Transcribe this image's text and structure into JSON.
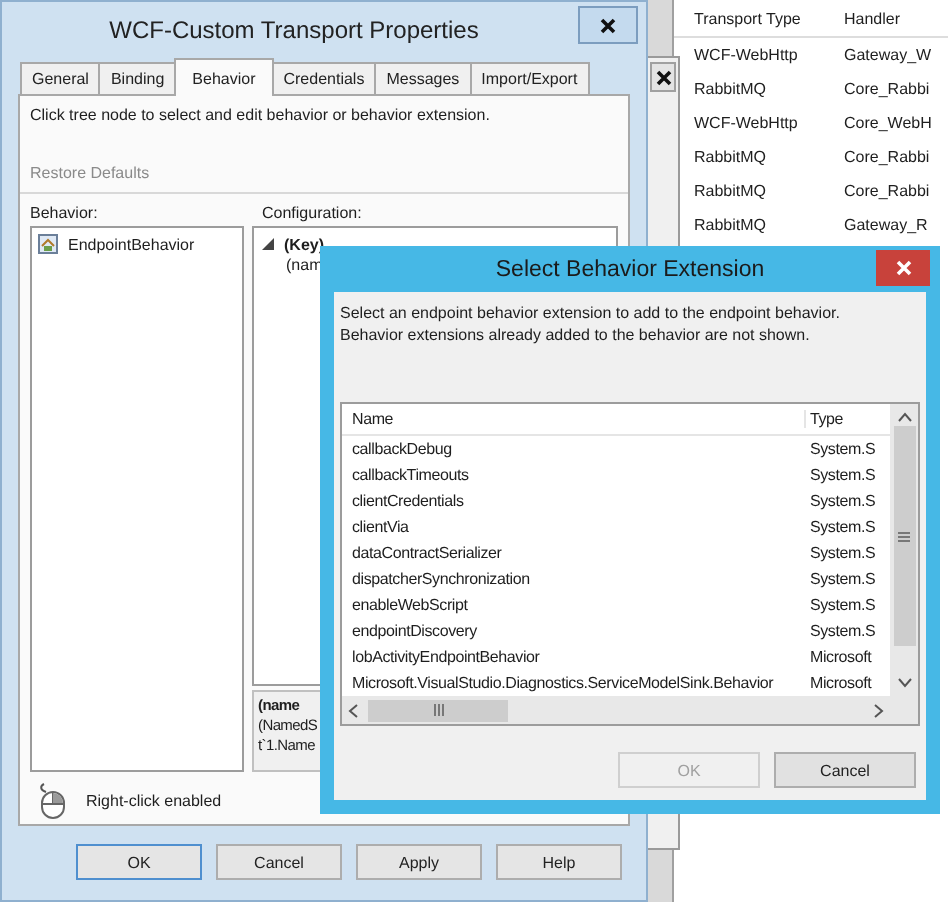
{
  "background_window": {
    "columns": [
      "Transport Type",
      "Handler"
    ],
    "rows": [
      [
        "WCF-WebHttp",
        "Gateway_W"
      ],
      [
        "RabbitMQ",
        "Core_Rabbi"
      ],
      [
        "WCF-WebHttp",
        "Core_WebH"
      ],
      [
        "RabbitMQ",
        "Core_Rabbi"
      ],
      [
        "RabbitMQ",
        "Core_Rabbi"
      ],
      [
        "RabbitMQ",
        "Gateway_R"
      ]
    ]
  },
  "properties_window": {
    "title": "WCF-Custom Transport Properties",
    "tabs": [
      {
        "label": "General",
        "selected": false
      },
      {
        "label": "Binding",
        "selected": false
      },
      {
        "label": "Behavior",
        "selected": true
      },
      {
        "label": "Credentials",
        "selected": false
      },
      {
        "label": "Messages",
        "selected": false
      },
      {
        "label": "Import/Export",
        "selected": false
      }
    ],
    "instructions": "Click tree node to select and edit behavior or behavior extension.",
    "restore_defaults": {
      "label": "Restore Defaults",
      "disabled": true
    },
    "behavior_label": "Behavior:",
    "behavior_tree": [
      {
        "label": "EndpointBehavior"
      }
    ],
    "configuration_label": "Configuration:",
    "configuration": [
      {
        "label": "(Key)",
        "kind": "category",
        "expanded": true
      },
      {
        "label": "(nam",
        "kind": "property"
      }
    ],
    "description": {
      "title": "(name",
      "lines": [
        "(NamedS",
        "t`1.Name"
      ]
    },
    "right_click_note": "Right-click enabled",
    "buttons": [
      {
        "label": "OK",
        "default": true
      },
      {
        "label": "Cancel",
        "default": false
      },
      {
        "label": "Apply",
        "default": false
      },
      {
        "label": "Help",
        "default": false
      }
    ]
  },
  "dialog": {
    "title": "Select Behavior Extension",
    "message_lines": [
      "Select an endpoint behavior extension to add to the endpoint behavior.",
      "Behavior extensions already added to the behavior are not shown."
    ],
    "columns": [
      "Name",
      "Type"
    ],
    "rows": [
      {
        "name": "callbackDebug",
        "type": "System.S"
      },
      {
        "name": "callbackTimeouts",
        "type": "System.S"
      },
      {
        "name": "clientCredentials",
        "type": "System.S"
      },
      {
        "name": "clientVia",
        "type": "System.S"
      },
      {
        "name": "dataContractSerializer",
        "type": "System.S"
      },
      {
        "name": "dispatcherSynchronization",
        "type": "System.S"
      },
      {
        "name": "enableWebScript",
        "type": "System.S"
      },
      {
        "name": "endpointDiscovery",
        "type": "System.S"
      },
      {
        "name": "lobActivityEndpointBehavior",
        "type": "Microsoft"
      },
      {
        "name": "Microsoft.VisualStudio.Diagnostics.ServiceModelSink.Behavior",
        "type": "Microsoft"
      }
    ],
    "buttons": [
      {
        "label": "OK",
        "disabled": true
      },
      {
        "label": "Cancel",
        "disabled": false
      }
    ]
  }
}
